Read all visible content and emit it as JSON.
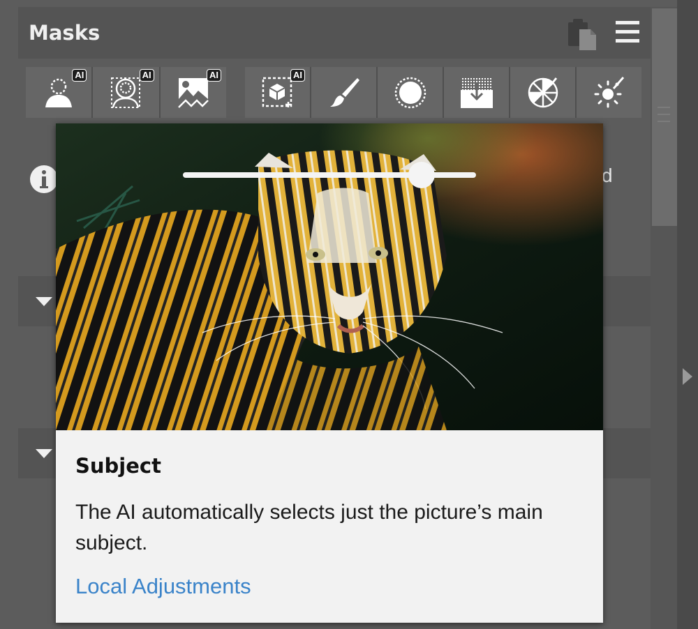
{
  "panel": {
    "title": "Masks",
    "header_icons": [
      "clipboard-icon",
      "hamburger-menu-icon"
    ]
  },
  "toolbar": {
    "group_ai": [
      {
        "icon": "subject-person-icon",
        "badge": "AI"
      },
      {
        "icon": "person-outline-icon",
        "badge": "AI"
      },
      {
        "icon": "landscape-sky-icon",
        "badge": "AI"
      }
    ],
    "group_tools": [
      {
        "icon": "object-cube-icon",
        "badge": "AI"
      },
      {
        "icon": "brush-icon",
        "badge": ""
      },
      {
        "icon": "radial-circle-icon",
        "badge": ""
      },
      {
        "icon": "linear-gradient-icon",
        "badge": ""
      },
      {
        "icon": "color-range-icon",
        "badge": ""
      },
      {
        "icon": "luminance-range-icon",
        "badge": ""
      }
    ]
  },
  "background": {
    "info_partial_text": "d"
  },
  "tooltip": {
    "title": "Subject",
    "description": "The AI automatically selects just the picture’s main subject.",
    "link": "Local Adjustments",
    "slider_value": 0.82
  },
  "colors": {
    "panel_bg": "#5c5c5c",
    "header_bg": "#545454",
    "tool_bg": "#666666",
    "link": "#3a83c9"
  }
}
